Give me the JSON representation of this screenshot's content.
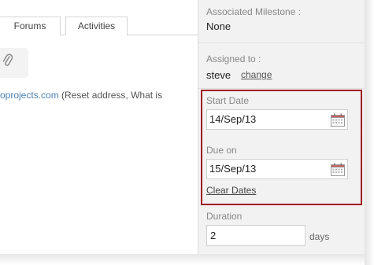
{
  "tabs": [
    {
      "label": "Forums"
    },
    {
      "label": "Activities"
    }
  ],
  "email_line": {
    "link_text": "oprojects.com",
    "suffix": " (Reset address, What is"
  },
  "sidebar": {
    "milestone": {
      "label": "Associated Milestone :",
      "value": "None"
    },
    "assigned": {
      "label": "Assigned to :",
      "value": "steve",
      "change_label": "change"
    },
    "start_date": {
      "label": "Start Date",
      "value": "14/Sep/13"
    },
    "due_on": {
      "label": "Due on",
      "value": "15/Sep/13"
    },
    "clear_dates_label": "Clear Dates",
    "duration": {
      "label": "Duration",
      "value": "2",
      "unit": "days"
    }
  },
  "icons": {
    "attachment": "paperclip-icon",
    "calendar": "calendar-icon"
  },
  "colors": {
    "highlight_border": "#a01b1b",
    "link": "#4a7fb6",
    "sidebar_bg": "#f2f2f2"
  }
}
